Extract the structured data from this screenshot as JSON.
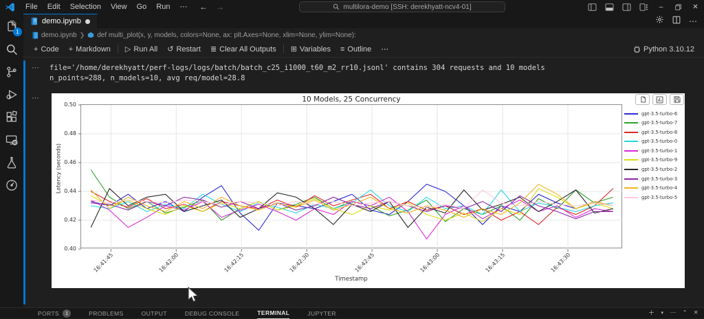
{
  "window": {
    "menus": [
      "File",
      "Edit",
      "Selection",
      "View",
      "Go",
      "Run",
      "⋯"
    ],
    "search_text": "multilora-demo [SSH: derekhyatt-ncv4-01]",
    "back_arrow": "←",
    "forward_arrow": "→"
  },
  "tab": {
    "label": "demo.ipynb"
  },
  "breadcrumb": {
    "file": "demo.ipynb",
    "separator": "❯",
    "symbol": "def multi_plot(x, y, models, colors=None, ax: plt.Axes=None, xlim=None, ylim=None):"
  },
  "toolbar": {
    "code": "Code",
    "markdown": "Markdown",
    "run_all": "Run All",
    "restart": "Restart",
    "clear_all": "Clear All Outputs",
    "variables": "Variables",
    "outline": "Outline",
    "more": "⋯",
    "kernel": "Python 3.10.12"
  },
  "output_text": {
    "gutter": "⋯",
    "line1": "file='/home/derekhyatt/perf-logs/logs/batch/batch_c25_i1000_t60_m2_rr10.jsonl' contains 304 requests and 10 models",
    "line2": "n_points=288, n_models=10, avg req/model=28.8"
  },
  "chart_data": {
    "type": "line",
    "title": "10 Models, 25 Concurrency",
    "xlabel": "Timestamp",
    "ylabel": "Latency (seconds)",
    "ylim": [
      0.4,
      0.5
    ],
    "yticks": [
      "0.50",
      "0.48",
      "0.46",
      "0.44",
      "0.42",
      "0.40"
    ],
    "xticks": [
      "16:41:45",
      "16:42:00",
      "16:42:15",
      "16:42:30",
      "16:42:45",
      "16:43:00",
      "16:43:15",
      "16:43:30"
    ],
    "grid": true,
    "legend_position": "right-outside",
    "series": [
      {
        "name": "gpt-3.5-turbo-6",
        "color": "#2a2ad4",
        "values": [
          0.433,
          0.43,
          0.438,
          0.428,
          0.433,
          0.426,
          0.436,
          0.444,
          0.425,
          0.413,
          0.432,
          0.43,
          0.428,
          0.433,
          0.438,
          0.427,
          0.424,
          0.433,
          0.445,
          0.44,
          0.43,
          0.417,
          0.43,
          0.426,
          0.438,
          0.432,
          0.428,
          0.433,
          0.43
        ]
      },
      {
        "name": "gpt-3.5-turbo-7",
        "color": "#2ca02c",
        "values": [
          0.455,
          0.436,
          0.428,
          0.433,
          0.425,
          0.429,
          0.434,
          0.42,
          0.428,
          0.433,
          0.427,
          0.431,
          0.436,
          0.428,
          0.433,
          0.43,
          0.423,
          0.427,
          0.434,
          0.419,
          0.428,
          0.424,
          0.43,
          0.42,
          0.435,
          0.428,
          0.441,
          0.432,
          0.436
        ]
      },
      {
        "name": "gpt-3.5-turbo-8",
        "color": "#e02424",
        "values": [
          0.44,
          0.433,
          0.429,
          0.435,
          0.428,
          0.431,
          0.426,
          0.433,
          0.43,
          0.428,
          0.434,
          0.429,
          0.437,
          0.43,
          0.434,
          0.438,
          0.428,
          0.433,
          0.427,
          0.43,
          0.424,
          0.428,
          0.42,
          0.426,
          0.417,
          0.429,
          0.424,
          0.43,
          0.442
        ]
      },
      {
        "name": "gpt-3.5-turbo-0",
        "color": "#22d8dc",
        "values": [
          0.43,
          0.428,
          0.433,
          0.426,
          0.431,
          0.428,
          0.438,
          0.431,
          0.426,
          0.432,
          0.429,
          0.425,
          0.431,
          0.428,
          0.432,
          0.441,
          0.43,
          0.426,
          0.436,
          0.428,
          0.43,
          0.424,
          0.441,
          0.426,
          0.432,
          0.429,
          0.426,
          0.43,
          0.432
        ]
      },
      {
        "name": "gpt-3.5-turbo-1",
        "color": "#d82ad8",
        "values": [
          0.434,
          0.427,
          0.415,
          0.422,
          0.43,
          0.427,
          0.433,
          0.422,
          0.427,
          0.431,
          0.426,
          0.42,
          0.428,
          0.424,
          0.433,
          0.43,
          0.436,
          0.426,
          0.407,
          0.424,
          0.43,
          0.421,
          0.428,
          0.434,
          0.426,
          0.43,
          0.422,
          0.428,
          0.426
        ]
      },
      {
        "name": "gpt-3.5-turbo-9",
        "color": "#dcdc10",
        "values": [
          0.437,
          0.43,
          0.434,
          0.428,
          0.424,
          0.43,
          0.426,
          0.432,
          0.428,
          0.433,
          0.427,
          0.43,
          0.435,
          0.428,
          0.424,
          0.43,
          0.427,
          0.432,
          0.424,
          0.42,
          0.425,
          0.419,
          0.428,
          0.424,
          0.442,
          0.436,
          0.428,
          0.432,
          0.428
        ]
      },
      {
        "name": "gpt-3.5-turbo-2",
        "color": "#262626",
        "values": [
          0.415,
          0.442,
          0.43,
          0.436,
          0.438,
          0.426,
          0.43,
          0.434,
          0.422,
          0.428,
          0.439,
          0.436,
          0.428,
          0.417,
          0.431,
          0.426,
          0.433,
          0.415,
          0.429,
          0.425,
          0.441,
          0.427,
          0.431,
          0.436,
          0.426,
          0.433,
          0.441,
          0.425,
          0.428
        ]
      },
      {
        "name": "gpt-3.5-turbo-3",
        "color": "#8c23a8",
        "values": [
          0.432,
          0.431,
          0.427,
          0.433,
          0.43,
          0.436,
          0.434,
          0.429,
          0.433,
          0.428,
          0.432,
          0.427,
          0.43,
          0.436,
          0.431,
          0.428,
          0.433,
          0.43,
          0.426,
          0.43,
          0.428,
          0.433,
          0.426,
          0.437,
          0.43,
          0.426,
          0.421,
          0.426,
          0.426
        ]
      },
      {
        "name": "gpt-3.5-turbo-4",
        "color": "#f0b41e",
        "values": [
          0.441,
          0.428,
          0.436,
          0.43,
          0.426,
          0.433,
          0.428,
          0.436,
          0.43,
          0.427,
          0.432,
          0.429,
          0.434,
          0.427,
          0.431,
          0.436,
          0.428,
          0.425,
          0.43,
          0.427,
          0.422,
          0.428,
          0.424,
          0.432,
          0.445,
          0.438,
          0.428,
          0.433,
          0.43
        ]
      },
      {
        "name": "gpt-3.5-turbo-5",
        "color": "#ffc9dc",
        "values": [
          0.434,
          0.432,
          0.434,
          0.433,
          0.432,
          0.434,
          0.433,
          0.431,
          0.433,
          0.432,
          0.43,
          0.433,
          0.431,
          0.433,
          0.43,
          0.432,
          0.433,
          0.43,
          0.429,
          0.431,
          0.428,
          0.441,
          0.432,
          0.43,
          0.433,
          0.431,
          0.43,
          0.432,
          0.43
        ]
      }
    ]
  },
  "panel": {
    "tabs": [
      {
        "label": "PORTS",
        "badge": "1"
      },
      {
        "label": "PROBLEMS"
      },
      {
        "label": "OUTPUT"
      },
      {
        "label": "DEBUG CONSOLE"
      },
      {
        "label": "TERMINAL",
        "active": true
      },
      {
        "label": "JUPYTER"
      }
    ]
  }
}
